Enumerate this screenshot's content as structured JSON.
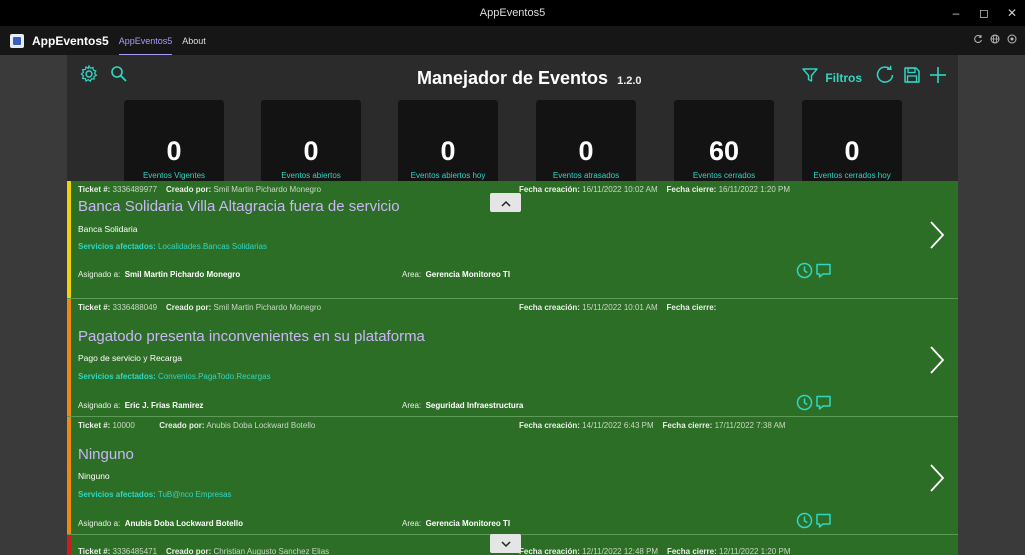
{
  "window": {
    "title": "AppEventos5"
  },
  "appbar": {
    "app_name": "AppEventos5",
    "tabs": [
      {
        "label": "AppEventos5",
        "active": true
      },
      {
        "label": "About",
        "active": false
      }
    ],
    "right_icons": [
      "refresh-icon",
      "globe-icon",
      "target-icon"
    ]
  },
  "header": {
    "title": "Manejador de Eventos",
    "version": "1.2.0",
    "filter_label": "Filtros"
  },
  "stats": [
    {
      "value": "0",
      "label": "Eventos Vigentes"
    },
    {
      "value": "0",
      "label": "Eventos abiertos"
    },
    {
      "value": "0",
      "label": "Eventos abiertos hoy"
    },
    {
      "value": "0",
      "label": "Eventos atrasados"
    },
    {
      "value": "60",
      "label": "Eventos cerrados"
    },
    {
      "value": "0",
      "label": "Eventos cerrados hoy"
    }
  ],
  "labels": {
    "ticket": "Ticket #:",
    "creado_por": "Creado por:",
    "fecha_creacion": "Fecha creación:",
    "fecha_cierre": "Fecha cierre:",
    "servicios": "Servicios afectados:",
    "asignado": "Asignado a:",
    "area": "Area:"
  },
  "events": [
    {
      "ticket": "3336489977",
      "created_by": "Smil Martin Pichardo Monegro",
      "created_date": "16/11/2022 10:02 AM",
      "closed_date": "16/11/2022 1:20 PM",
      "title": "Banca Solidaria Villa Altagracia fuera de servicio",
      "category": "Banca Solidaria",
      "services": "Localidades.Bancas Solidarias",
      "assigned_to": "Smil Martin Pichardo Monegro",
      "area": "Gerencia Monitoreo TI",
      "stripe_color": "#f0d20a"
    },
    {
      "ticket": "3336488049",
      "created_by": "Smil Martin Pichardo Monegro",
      "created_date": "15/11/2022 10:01 AM",
      "closed_date": "",
      "title": "Pagatodo presenta inconvenientes en su plataforma",
      "category": "Pago de servicio y Recarga",
      "services": "Convenios.PagaTodo.Recargas",
      "assigned_to": "Eric J. Frias Ramirez",
      "area": "Seguridad Infraestructura",
      "stripe_color": "#f08a0c"
    },
    {
      "ticket": "10000",
      "created_by": "Anubis Doba Lockward Botello",
      "created_date": "14/11/2022 6:43 PM",
      "closed_date": "17/11/2022 7:38 AM",
      "title": "Ninguno",
      "category": "Ninguno",
      "services": "TuB@nco Empresas",
      "assigned_to": "Anubis Doba Lockward Botello",
      "area": "Gerencia Monitoreo TI",
      "stripe_color": "#f08a0c"
    },
    {
      "ticket": "3336485471",
      "created_by": "Christian Augusto Sanchez Elias",
      "created_date": "12/11/2022 12:48 PM",
      "closed_date": "12/11/2022 1:20 PM",
      "title": "",
      "category": "",
      "services": "",
      "assigned_to": "",
      "area": "",
      "stripe_color": "#c81e1e"
    }
  ],
  "colors": {
    "accent_teal": "#2fd6c3",
    "title_purple": "#c9b6f7",
    "card_green": "#2d6e26",
    "tab_active": "#a89cf5"
  }
}
